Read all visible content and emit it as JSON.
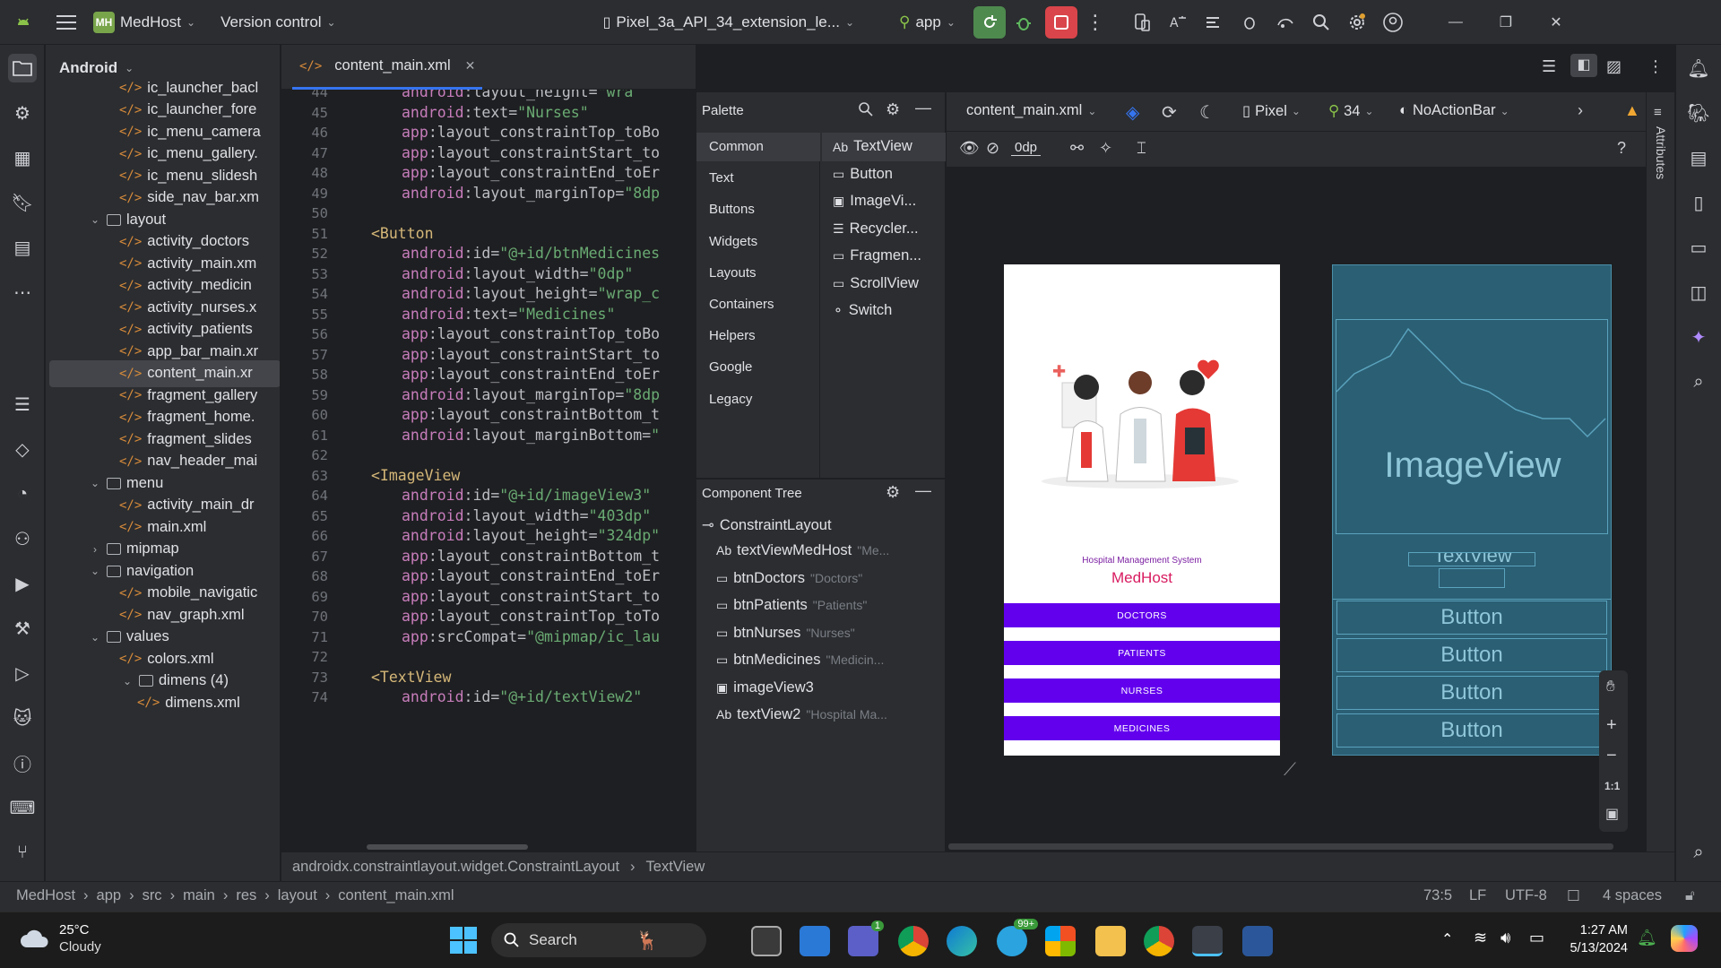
{
  "titlebar": {
    "app_logo": "MH",
    "project_name": "MedHost",
    "vcs_label": "Version control",
    "device_name": "Pixel_3a_API_34_extension_le...",
    "run_config": "app"
  },
  "project_panel": {
    "title": "Android",
    "rows": [
      {
        "label": "ic_launcher_bacl",
        "type": "file",
        "indent": 3
      },
      {
        "label": "ic_launcher_fore",
        "type": "file",
        "indent": 3
      },
      {
        "label": "ic_menu_camera",
        "type": "file",
        "indent": 3
      },
      {
        "label": "ic_menu_gallery.",
        "type": "file",
        "indent": 3
      },
      {
        "label": "ic_menu_slidesh",
        "type": "file",
        "indent": 3
      },
      {
        "label": "side_nav_bar.xm",
        "type": "file",
        "indent": 3
      },
      {
        "label": "layout",
        "type": "folder",
        "indent": 2,
        "open": true
      },
      {
        "label": "activity_doctors",
        "type": "file",
        "indent": 3
      },
      {
        "label": "activity_main.xm",
        "type": "file",
        "indent": 3
      },
      {
        "label": "activity_medicin",
        "type": "file",
        "indent": 3
      },
      {
        "label": "activity_nurses.x",
        "type": "file",
        "indent": 3
      },
      {
        "label": "activity_patients",
        "type": "file",
        "indent": 3
      },
      {
        "label": "app_bar_main.xr",
        "type": "file",
        "indent": 3
      },
      {
        "label": "content_main.xr",
        "type": "file",
        "indent": 3,
        "selected": true
      },
      {
        "label": "fragment_gallery",
        "type": "file",
        "indent": 3
      },
      {
        "label": "fragment_home.",
        "type": "file",
        "indent": 3
      },
      {
        "label": "fragment_slides",
        "type": "file",
        "indent": 3
      },
      {
        "label": "nav_header_mai",
        "type": "file",
        "indent": 3
      },
      {
        "label": "menu",
        "type": "folder",
        "indent": 2,
        "open": true
      },
      {
        "label": "activity_main_dr",
        "type": "file",
        "indent": 3
      },
      {
        "label": "main.xml",
        "type": "file",
        "indent": 3
      },
      {
        "label": "mipmap",
        "type": "folder",
        "indent": 2,
        "open": false
      },
      {
        "label": "navigation",
        "type": "folder",
        "indent": 2,
        "open": true
      },
      {
        "label": "mobile_navigatic",
        "type": "file",
        "indent": 3
      },
      {
        "label": "nav_graph.xml",
        "type": "file",
        "indent": 3
      },
      {
        "label": "values",
        "type": "folder",
        "indent": 2,
        "open": true
      },
      {
        "label": "colors.xml",
        "type": "file",
        "indent": 3
      },
      {
        "label": "dimens (4)",
        "type": "folder",
        "indent": 3,
        "open": true
      },
      {
        "label": "dimens.xml",
        "type": "file",
        "indent": 4
      }
    ]
  },
  "editor": {
    "tab_label": "content_main.xml",
    "lines": [
      {
        "n": "44",
        "ns": "android",
        "attr": ":layout_height=",
        "val": "\"wra"
      },
      {
        "n": "45",
        "ns": "android",
        "attr": ":text=",
        "val": "\"Nurses\""
      },
      {
        "n": "46",
        "ns": "app",
        "attr": ":layout_constraintTop_toBo",
        "val": ""
      },
      {
        "n": "47",
        "ns": "app",
        "attr": ":layout_constraintStart_to",
        "val": ""
      },
      {
        "n": "48",
        "ns": "app",
        "attr": ":layout_constraintEnd_toEr",
        "val": ""
      },
      {
        "n": "49",
        "ns": "android",
        "attr": ":layout_marginTop=",
        "val": "\"8dp"
      },
      {
        "n": "50",
        "ns": "",
        "attr": "",
        "val": ""
      },
      {
        "n": "51",
        "tag": "<Button"
      },
      {
        "n": "52",
        "ns": "android",
        "attr": ":id=",
        "val": "\"@+id/btnMedicines"
      },
      {
        "n": "53",
        "ns": "android",
        "attr": ":layout_width=",
        "val": "\"0dp\""
      },
      {
        "n": "54",
        "ns": "android",
        "attr": ":layout_height=",
        "val": "\"wrap_c"
      },
      {
        "n": "55",
        "ns": "android",
        "attr": ":text=",
        "val": "\"Medicines\""
      },
      {
        "n": "56",
        "ns": "app",
        "attr": ":layout_constraintTop_toBo",
        "val": ""
      },
      {
        "n": "57",
        "ns": "app",
        "attr": ":layout_constraintStart_to",
        "val": ""
      },
      {
        "n": "58",
        "ns": "app",
        "attr": ":layout_constraintEnd_toEr",
        "val": ""
      },
      {
        "n": "59",
        "ns": "android",
        "attr": ":layout_marginTop=",
        "val": "\"8dp"
      },
      {
        "n": "60",
        "ns": "app",
        "attr": ":layout_constraintBottom_t",
        "val": ""
      },
      {
        "n": "61",
        "ns": "android",
        "attr": ":layout_marginBottom=",
        "val": "\""
      },
      {
        "n": "62",
        "ns": "",
        "attr": "",
        "val": ""
      },
      {
        "n": "63",
        "tag": "<ImageView"
      },
      {
        "n": "64",
        "ns": "android",
        "attr": ":id=",
        "val": "\"@+id/imageView3\""
      },
      {
        "n": "65",
        "ns": "android",
        "attr": ":layout_width=",
        "val": "\"403dp\""
      },
      {
        "n": "66",
        "ns": "android",
        "attr": ":layout_height=",
        "val": "\"324dp\""
      },
      {
        "n": "67",
        "ns": "app",
        "attr": ":layout_constraintBottom_t",
        "val": ""
      },
      {
        "n": "68",
        "ns": "app",
        "attr": ":layout_constraintEnd_toEr",
        "val": ""
      },
      {
        "n": "69",
        "ns": "app",
        "attr": ":layout_constraintStart_to",
        "val": ""
      },
      {
        "n": "70",
        "ns": "app",
        "attr": ":layout_constraintTop_toTo",
        "val": ""
      },
      {
        "n": "71",
        "ns": "app",
        "attr": ":srcCompat=",
        "val": "\"@mipmap/ic_lau"
      },
      {
        "n": "72",
        "ns": "",
        "attr": "",
        "val": ""
      },
      {
        "n": "73",
        "tag": "<TextView"
      },
      {
        "n": "74",
        "ns": "android",
        "attr": ":id=",
        "val": "\"@+id/textView2\""
      }
    ]
  },
  "palette": {
    "title": "Palette",
    "categories": [
      "Common",
      "Text",
      "Buttons",
      "Widgets",
      "Layouts",
      "Containers",
      "Helpers",
      "Google",
      "Legacy"
    ],
    "items": [
      {
        "icon": "Ab",
        "label": "TextView"
      },
      {
        "icon": "▭",
        "label": "Button"
      },
      {
        "icon": "▣",
        "label": "ImageVi..."
      },
      {
        "icon": "☰",
        "label": "Recycler..."
      },
      {
        "icon": "▭",
        "label": "Fragmen..."
      },
      {
        "icon": "▭",
        "label": "ScrollView"
      },
      {
        "icon": "⚬",
        "label": "Switch"
      }
    ]
  },
  "component_tree": {
    "title": "Component Tree",
    "root": "ConstraintLayout",
    "rows": [
      {
        "icon": "Ab",
        "label": "textViewMedHost",
        "hint": "\"Me..."
      },
      {
        "icon": "▭",
        "label": "btnDoctors",
        "hint": "\"Doctors\""
      },
      {
        "icon": "▭",
        "label": "btnPatients",
        "hint": "\"Patients\""
      },
      {
        "icon": "▭",
        "label": "btnNurses",
        "hint": "\"Nurses\""
      },
      {
        "icon": "▭",
        "label": "btnMedicines",
        "hint": "\"Medicin..."
      },
      {
        "icon": "▣",
        "label": "imageView3",
        "hint": ""
      },
      {
        "icon": "Ab",
        "label": "textView2",
        "hint": "\"Hospital Ma..."
      }
    ]
  },
  "design_toolbar": {
    "file": "content_main.xml",
    "device": "Pixel",
    "api": "34",
    "theme": "NoActionBar",
    "margin": "0dp"
  },
  "phone_preview": {
    "subtitle": "Hospital Management System",
    "title": "MedHost",
    "buttons": [
      "DOCTORS",
      "PATIENTS",
      "NURSES",
      "MEDICINES"
    ]
  },
  "blueprint": {
    "image_label": "ImageView",
    "text_label": "TextView",
    "buttons": [
      "Button",
      "Button",
      "Button",
      "Button"
    ]
  },
  "zoom_controls": {
    "fit_label": "1:1"
  },
  "right_panel_label": "Attributes",
  "xml_crumb": [
    "androidx.constraintlayout.widget.ConstraintLayout",
    "TextView"
  ],
  "status": {
    "path": [
      "MedHost",
      "app",
      "src",
      "main",
      "res",
      "layout",
      "content_main.xml"
    ],
    "position": "73:5",
    "line_sep": "LF",
    "encoding": "UTF-8",
    "indent": "4 spaces"
  },
  "taskbar": {
    "weather_temp": "25°C",
    "weather_desc": "Cloudy",
    "search_label": "Search",
    "time": "1:27 AM",
    "date": "5/13/2024",
    "teams_badge": "1",
    "telegram_badge": "99+"
  },
  "colors": {
    "accent": "#6200ee",
    "run_green": "#4caf50",
    "stop_red": "#e5484d"
  }
}
